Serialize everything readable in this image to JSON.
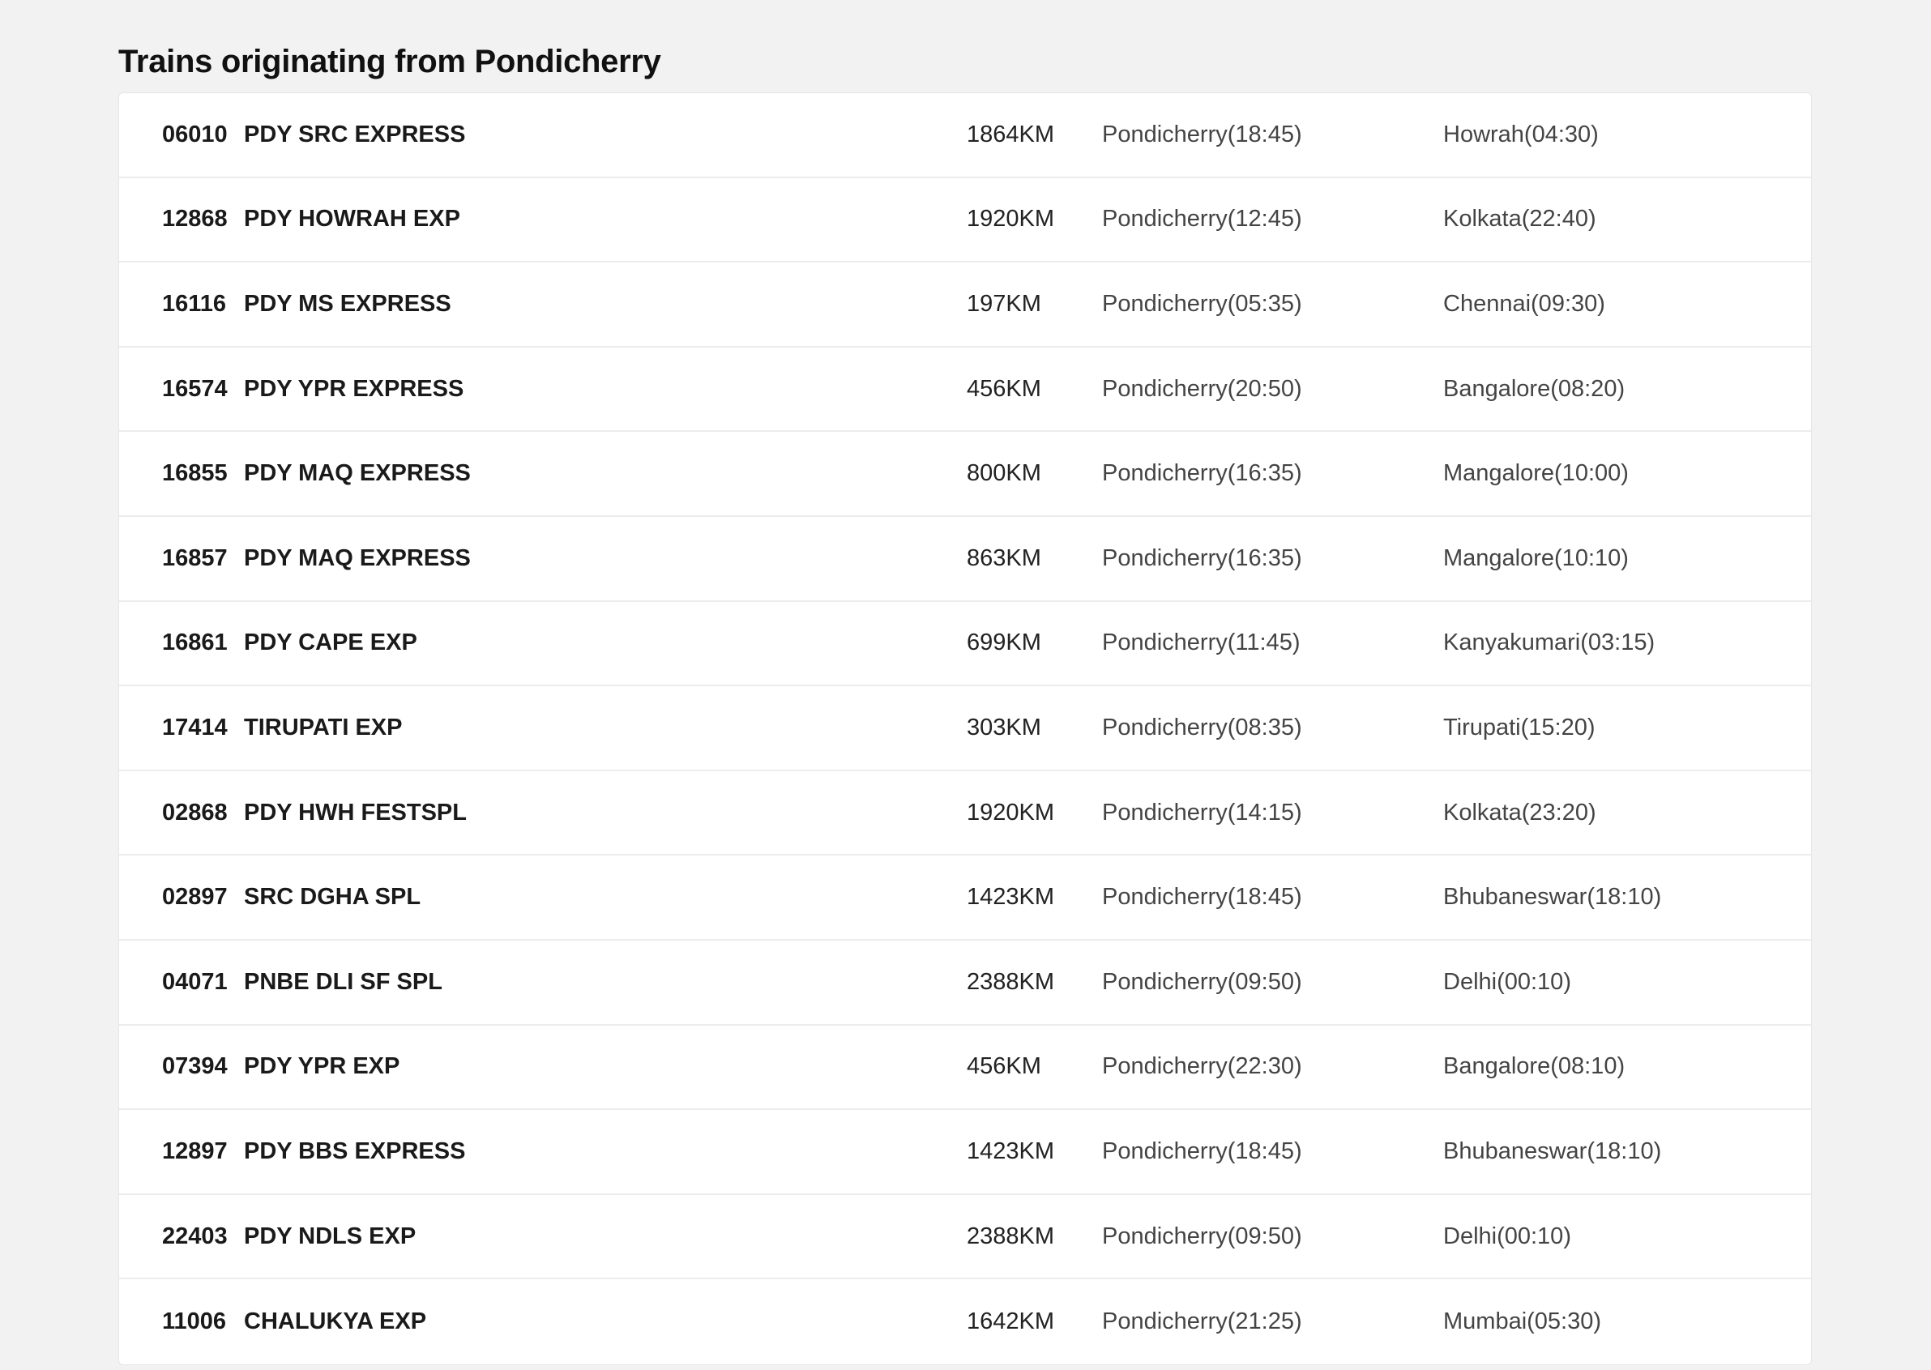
{
  "section": {
    "title": "Trains originating from Pondicherry"
  },
  "trains": [
    {
      "number": "06010",
      "name": "PDY SRC EXPRESS",
      "distance": "1864KM",
      "departure": "Pondicherry(18:45)",
      "arrival": "Howrah(04:30)"
    },
    {
      "number": "12868",
      "name": "PDY HOWRAH EXP",
      "distance": "1920KM",
      "departure": "Pondicherry(12:45)",
      "arrival": "Kolkata(22:40)"
    },
    {
      "number": "16116",
      "name": "PDY MS EXPRESS",
      "distance": "197KM",
      "departure": "Pondicherry(05:35)",
      "arrival": "Chennai(09:30)"
    },
    {
      "number": "16574",
      "name": "PDY YPR EXPRESS",
      "distance": "456KM",
      "departure": "Pondicherry(20:50)",
      "arrival": "Bangalore(08:20)"
    },
    {
      "number": "16855",
      "name": "PDY MAQ EXPRESS",
      "distance": "800KM",
      "departure": "Pondicherry(16:35)",
      "arrival": "Mangalore(10:00)"
    },
    {
      "number": "16857",
      "name": "PDY MAQ EXPRESS",
      "distance": "863KM",
      "departure": "Pondicherry(16:35)",
      "arrival": "Mangalore(10:10)"
    },
    {
      "number": "16861",
      "name": "PDY CAPE EXP",
      "distance": "699KM",
      "departure": "Pondicherry(11:45)",
      "arrival": "Kanyakumari(03:15)"
    },
    {
      "number": "17414",
      "name": "TIRUPATI EXP",
      "distance": "303KM",
      "departure": "Pondicherry(08:35)",
      "arrival": "Tirupati(15:20)"
    },
    {
      "number": "02868",
      "name": "PDY HWH FESTSPL",
      "distance": "1920KM",
      "departure": "Pondicherry(14:15)",
      "arrival": "Kolkata(23:20)"
    },
    {
      "number": "02897",
      "name": "SRC DGHA SPL",
      "distance": "1423KM",
      "departure": "Pondicherry(18:45)",
      "arrival": "Bhubaneswar(18:10)"
    },
    {
      "number": "04071",
      "name": "PNBE DLI SF SPL",
      "distance": "2388KM",
      "departure": "Pondicherry(09:50)",
      "arrival": "Delhi(00:10)"
    },
    {
      "number": "07394",
      "name": "PDY YPR EXP",
      "distance": "456KM",
      "departure": "Pondicherry(22:30)",
      "arrival": "Bangalore(08:10)"
    },
    {
      "number": "12897",
      "name": "PDY BBS EXPRESS",
      "distance": "1423KM",
      "departure": "Pondicherry(18:45)",
      "arrival": "Bhubaneswar(18:10)"
    },
    {
      "number": "22403",
      "name": "PDY NDLS EXP",
      "distance": "2388KM",
      "departure": "Pondicherry(09:50)",
      "arrival": "Delhi(00:10)"
    },
    {
      "number": "11006",
      "name": "CHALUKYA EXP",
      "distance": "1642KM",
      "departure": "Pondicherry(21:25)",
      "arrival": "Mumbai(05:30)"
    }
  ]
}
